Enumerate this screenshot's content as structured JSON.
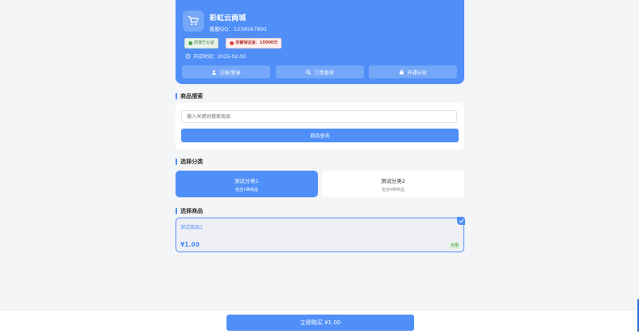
{
  "shop": {
    "name": "彩虹云商城",
    "qq": "客服QQ：1234567891",
    "badge_verified": "商家已认证",
    "badge_deposit": "信誉保证金：10000元",
    "open_time": "开店时间：2025-02-03",
    "buttons": [
      "注册/登录",
      "订单查询",
      "开通分站"
    ],
    "accent": "#4f8ff7"
  },
  "search": {
    "title": "商品搜索",
    "placeholder": "输入关键词搜索商品",
    "button": "商品查询"
  },
  "category": {
    "title": "选择分类",
    "items": [
      {
        "name": "测试分类1",
        "count": "包含1种商品",
        "selected": true
      },
      {
        "name": "测试分类2",
        "count": "包含0种商品",
        "selected": false
      }
    ]
  },
  "product": {
    "title": "选择商品",
    "items": [
      {
        "name": "测试商品1",
        "price": "¥1.00",
        "stock": "无限",
        "selected": true
      }
    ]
  },
  "footer": {
    "buy_button": "立即购买 ¥1.00"
  }
}
